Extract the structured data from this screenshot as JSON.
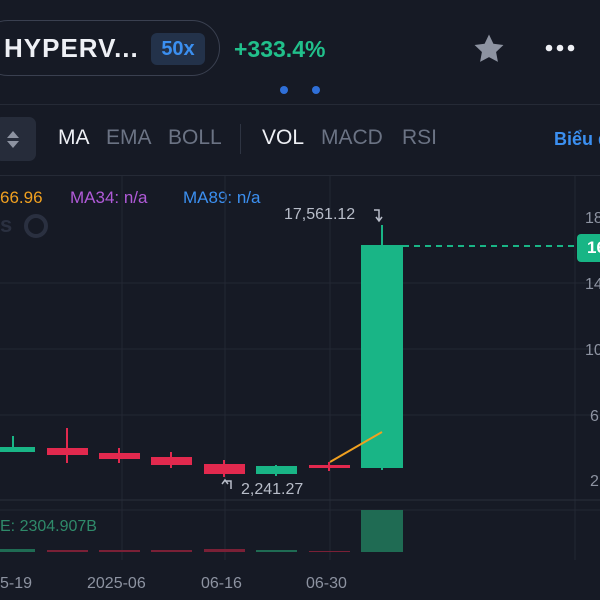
{
  "header": {
    "pair_name": "HYPERV...",
    "leverage": "50x",
    "change": "+333.4%",
    "star_icon": "star-icon",
    "more_icon": "more-dots-icon"
  },
  "indicators": {
    "tabs": [
      "MA",
      "EMA",
      "BOLL",
      "VOL",
      "MACD",
      "RSI"
    ],
    "active": [
      "MA",
      "VOL"
    ],
    "link": "Biểu đ"
  },
  "ma_legend": {
    "ma_first": "66.96",
    "ma34": "MA34: n/a",
    "ma89": "MA89: n/a"
  },
  "chart_data": {
    "type": "candlestick",
    "candles": [
      {
        "dir": "up"
      },
      {
        "dir": "down"
      },
      {
        "dir": "down"
      },
      {
        "dir": "down"
      },
      {
        "dir": "down"
      },
      {
        "dir": "up"
      },
      {
        "dir": "down"
      },
      {
        "dir": "up"
      }
    ],
    "high_label": "17,561.12",
    "low_label": "2,241.27",
    "volume_label": "E: 2304.907B",
    "x_ticks": [
      "5-19",
      "2025-06",
      "06-16",
      "06-30"
    ],
    "y_ticks": [
      "18",
      "14",
      "10",
      "6",
      "2"
    ],
    "current_price_label": "16",
    "colors": {
      "up": "#19b586",
      "down": "#e2294e",
      "ma": "#f0a020",
      "grid": "#232834"
    }
  }
}
